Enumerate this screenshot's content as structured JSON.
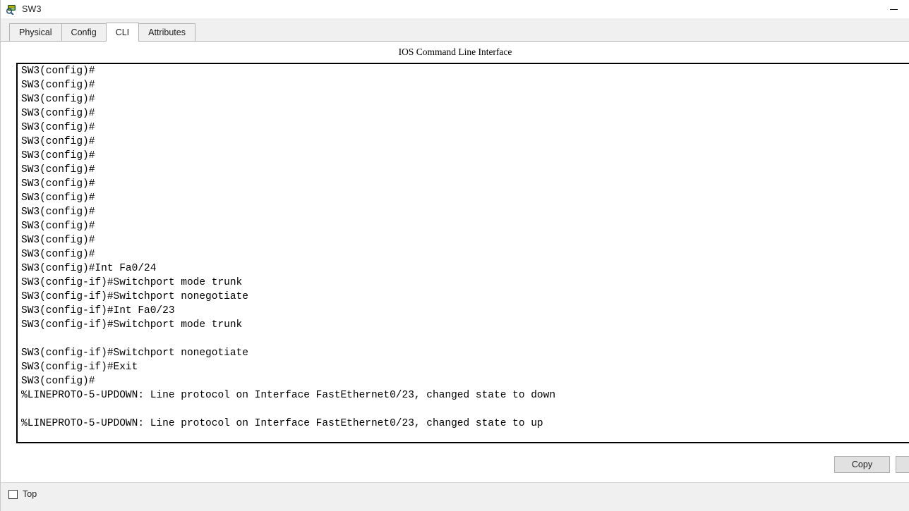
{
  "window": {
    "title": "SW3",
    "icon": "switch-magnifier-icon",
    "minimize_label": "—"
  },
  "tabs": [
    {
      "label": "Physical",
      "active": false
    },
    {
      "label": "Config",
      "active": false
    },
    {
      "label": "CLI",
      "active": true
    },
    {
      "label": "Attributes",
      "active": false
    }
  ],
  "panel": {
    "title": "IOS Command Line Interface"
  },
  "terminal": {
    "lines": [
      "SW3(config)#",
      "SW3(config)#",
      "SW3(config)#",
      "SW3(config)#",
      "SW3(config)#",
      "SW3(config)#",
      "SW3(config)#",
      "SW3(config)#",
      "SW3(config)#",
      "SW3(config)#",
      "SW3(config)#",
      "SW3(config)#",
      "SW3(config)#",
      "SW3(config)#",
      "SW3(config)#Int Fa0/24",
      "SW3(config-if)#Switchport mode trunk",
      "SW3(config-if)#Switchport nonegotiate",
      "SW3(config-if)#Int Fa0/23",
      "SW3(config-if)#Switchport mode trunk",
      "",
      "SW3(config-if)#Switchport nonegotiate",
      "SW3(config-if)#Exit",
      "SW3(config)#",
      "%LINEPROTO-5-UPDOWN: Line protocol on Interface FastEthernet0/23, changed state to down",
      "",
      "%LINEPROTO-5-UPDOWN: Line protocol on Interface FastEthernet0/23, changed state to up",
      ""
    ]
  },
  "buttons": {
    "copy": "Copy",
    "paste": ""
  },
  "footer": {
    "top_checkbox_label": "Top",
    "top_checkbox_checked": false
  },
  "colors": {
    "window_chrome": "#f0f0f0",
    "panel_bg": "#ffffff",
    "terminal_border": "#000000",
    "terminal_text": "#000000",
    "button_face": "#e1e1e1",
    "tab_border": "#b4b4b4"
  }
}
